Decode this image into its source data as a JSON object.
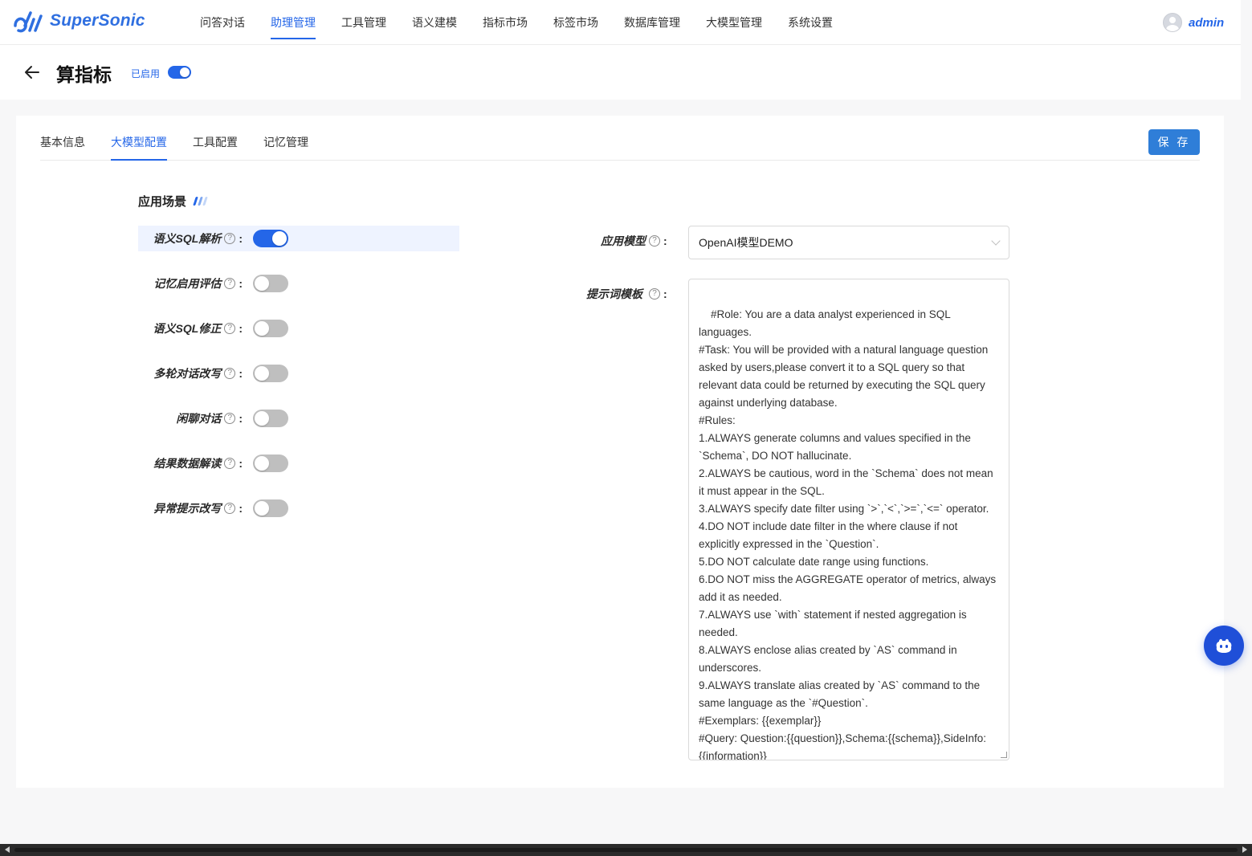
{
  "app": {
    "name": "SuperSonic",
    "logo_icon": "supersonic-logo-icon",
    "brand_color": "#2466e8"
  },
  "nav": {
    "items": [
      {
        "label": "问答对话",
        "active": false
      },
      {
        "label": "助理管理",
        "active": true
      },
      {
        "label": "工具管理",
        "active": false
      },
      {
        "label": "语义建模",
        "active": false
      },
      {
        "label": "指标市场",
        "active": false
      },
      {
        "label": "标签市场",
        "active": false
      },
      {
        "label": "数据库管理",
        "active": false
      },
      {
        "label": "大模型管理",
        "active": false
      },
      {
        "label": "系统设置",
        "active": false
      }
    ]
  },
  "user": {
    "name": "admin",
    "avatar_icon": "user-avatar-icon"
  },
  "page": {
    "title": "算指标",
    "status_label": "已启用",
    "enabled": true,
    "back_icon": "arrow-left-icon"
  },
  "tabs": [
    {
      "label": "基本信息",
      "active": false
    },
    {
      "label": "大模型配置",
      "active": true
    },
    {
      "label": "工具配置",
      "active": false
    },
    {
      "label": "记忆管理",
      "active": false
    }
  ],
  "save_label": "保 存",
  "section": {
    "title": "应用场景"
  },
  "scenarios": [
    {
      "label": "语义SQL解析",
      "enabled": true
    },
    {
      "label": "记忆启用评估",
      "enabled": false
    },
    {
      "label": "语义SQL修正",
      "enabled": false
    },
    {
      "label": "多轮对话改写",
      "enabled": false
    },
    {
      "label": "闲聊对话",
      "enabled": false
    },
    {
      "label": "结果数据解读",
      "enabled": false
    },
    {
      "label": "异常提示改写",
      "enabled": false
    }
  ],
  "model_field": {
    "label": "应用模型",
    "value": "OpenAI模型DEMO"
  },
  "prompt_field": {
    "label": "提示词模板",
    "value": "#Role: You are a data analyst experienced in SQL languages.\n#Task: You will be provided with a natural language question asked by users,please convert it to a SQL query so that relevant data could be returned by executing the SQL query against underlying database.\n#Rules:\n1.ALWAYS generate columns and values specified in the `Schema`, DO NOT hallucinate.\n2.ALWAYS be cautious, word in the `Schema` does not mean it must appear in the SQL.\n3.ALWAYS specify date filter using `>`,`<`,`>=`,`<=` operator.\n4.DO NOT include date filter in the where clause if not explicitly expressed in the `Question`.\n5.DO NOT calculate date range using functions.\n6.DO NOT miss the AGGREGATE operator of metrics, always add it as needed.\n7.ALWAYS use `with` statement if nested aggregation is needed.\n8.ALWAYS enclose alias created by `AS` command in underscores.\n9.ALWAYS translate alias created by `AS` command to the same language as the `#Question`.\n#Exemplars: {{exemplar}}\n#Query: Question:{{question}},Schema:{{schema}},SideInfo:{{information}}"
  },
  "help_glyph": "?",
  "colon": ":",
  "assistant_icon": "robot-assistant-icon",
  "colors": {
    "primary": "#2466e8",
    "save_button": "#2f7ed8",
    "switch_off": "#bfbfbf",
    "highlight_row": "#eef3ff",
    "float_button": "#1f4fd8"
  }
}
